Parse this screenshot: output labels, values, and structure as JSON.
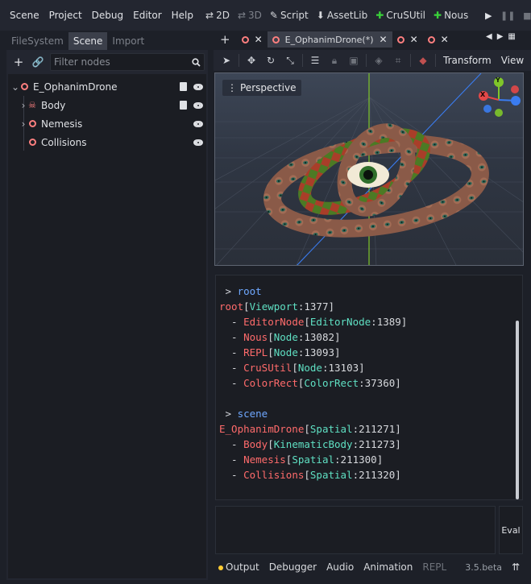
{
  "menu": {
    "items": [
      "Scene",
      "Project",
      "Debug",
      "Editor",
      "Help"
    ],
    "tools": [
      {
        "icon": "2d-icon",
        "label": "2D",
        "dim": false
      },
      {
        "icon": "3d-icon",
        "label": "3D",
        "dim": true
      },
      {
        "icon": "script-icon",
        "label": "Script",
        "dim": false
      },
      {
        "icon": "assetlib-icon",
        "label": "AssetLib",
        "dim": false
      },
      {
        "icon": "crusutil-icon",
        "label": "CruSUtil",
        "dim": false
      },
      {
        "icon": "nous-icon",
        "label": "Nous",
        "dim": false
      }
    ],
    "play_controls": [
      "play-icon",
      "pause-icon",
      "stop-icon",
      "movie-icon"
    ]
  },
  "left_dock": {
    "tabs": [
      {
        "label": "FileSystem",
        "active": false
      },
      {
        "label": "Scene",
        "active": true
      },
      {
        "label": "Import",
        "active": false
      }
    ],
    "filter_placeholder": "Filter nodes",
    "tree": [
      {
        "name": "E_OphanimDrone",
        "arrow": "down",
        "icon": "spatial-icon",
        "script": true,
        "visible": true,
        "indent": 0
      },
      {
        "name": "Body",
        "arrow": "right",
        "icon": "kinematic-body-icon",
        "script": true,
        "visible": true,
        "indent": 1
      },
      {
        "name": "Nemesis",
        "arrow": "right",
        "icon": "spatial-icon",
        "script": false,
        "visible": true,
        "indent": 1
      },
      {
        "name": "Collisions",
        "arrow": "",
        "icon": "spatial-icon",
        "script": false,
        "visible": true,
        "indent": 1
      }
    ]
  },
  "scene_tabs": [
    {
      "label": "",
      "active": false
    },
    {
      "label": "E_OphanimDrone(*)",
      "active": true
    },
    {
      "label": "",
      "active": false
    },
    {
      "label": "",
      "active": false
    }
  ],
  "viewport_toolbar": {
    "transform_label": "Transform",
    "view_label": "View"
  },
  "viewport": {
    "perspective_label": "Perspective",
    "gizmo_y_label": "Y",
    "gizmo_x_label": "X"
  },
  "repl": {
    "lines": [
      {
        "parts": [
          [
            " > ",
            "prompt"
          ],
          [
            "root",
            "kw"
          ]
        ]
      },
      {
        "parts": [
          [
            "root",
            "node"
          ],
          [
            "[",
            "punc"
          ],
          [
            "Viewport",
            "type"
          ],
          [
            ":1377]",
            "num"
          ]
        ]
      },
      {
        "parts": [
          [
            "  - ",
            "punc"
          ],
          [
            "EditorNode",
            "node"
          ],
          [
            "[",
            "punc"
          ],
          [
            "EditorNode",
            "type"
          ],
          [
            ":1389]",
            "num"
          ]
        ]
      },
      {
        "parts": [
          [
            "  - ",
            "punc"
          ],
          [
            "Nous",
            "node"
          ],
          [
            "[",
            "punc"
          ],
          [
            "Node",
            "type"
          ],
          [
            ":13082]",
            "num"
          ]
        ]
      },
      {
        "parts": [
          [
            "  - ",
            "punc"
          ],
          [
            "REPL",
            "node"
          ],
          [
            "[",
            "punc"
          ],
          [
            "Node",
            "type"
          ],
          [
            ":13093]",
            "num"
          ]
        ]
      },
      {
        "parts": [
          [
            "  - ",
            "punc"
          ],
          [
            "CruSUtil",
            "node"
          ],
          [
            "[",
            "punc"
          ],
          [
            "Node",
            "type"
          ],
          [
            ":13103]",
            "num"
          ]
        ]
      },
      {
        "parts": [
          [
            "  - ",
            "punc"
          ],
          [
            "ColorRect",
            "node"
          ],
          [
            "[",
            "punc"
          ],
          [
            "ColorRect",
            "type"
          ],
          [
            ":37360]",
            "num"
          ]
        ]
      },
      {
        "parts": [
          [
            "",
            "punc"
          ]
        ]
      },
      {
        "parts": [
          [
            " > ",
            "prompt"
          ],
          [
            "scene",
            "kw"
          ]
        ]
      },
      {
        "parts": [
          [
            "E_OphanimDrone",
            "node"
          ],
          [
            "[",
            "punc"
          ],
          [
            "Spatial",
            "type"
          ],
          [
            ":211271]",
            "num"
          ]
        ]
      },
      {
        "parts": [
          [
            "  - ",
            "punc"
          ],
          [
            "Body",
            "node"
          ],
          [
            "[",
            "punc"
          ],
          [
            "KinematicBody",
            "type"
          ],
          [
            ":211273]",
            "num"
          ]
        ]
      },
      {
        "parts": [
          [
            "  - ",
            "punc"
          ],
          [
            "Nemesis",
            "node"
          ],
          [
            "[",
            "punc"
          ],
          [
            "Spatial",
            "type"
          ],
          [
            ":211300]",
            "num"
          ]
        ]
      },
      {
        "parts": [
          [
            "  - ",
            "punc"
          ],
          [
            "Collisions",
            "node"
          ],
          [
            "[",
            "punc"
          ],
          [
            "Spatial",
            "type"
          ],
          [
            ":211320]",
            "num"
          ]
        ]
      }
    ],
    "eval_label": "Eval",
    "input_value": ""
  },
  "bottom_bar": {
    "tabs": [
      {
        "label": "Output",
        "dim": false,
        "dot": true
      },
      {
        "label": "Debugger",
        "dim": false,
        "dot": false
      },
      {
        "label": "Audio",
        "dim": false,
        "dot": false
      },
      {
        "label": "Animation",
        "dim": false,
        "dot": false
      },
      {
        "label": "REPL",
        "dim": true,
        "dot": false
      }
    ],
    "version": "3.5.beta"
  },
  "colors": {
    "accent": "#fc7f7f",
    "node_name": "#ff6b6b",
    "type_name": "#5fe0c3",
    "keyword": "#6fa8ff",
    "crusutil_green": "#3ad13a"
  }
}
